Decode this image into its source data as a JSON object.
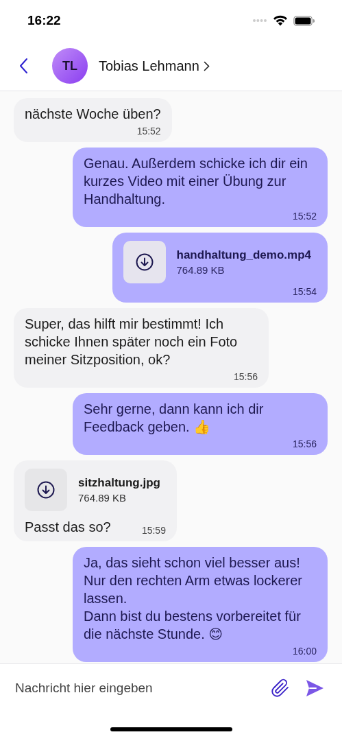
{
  "status_bar": {
    "time": "16:22"
  },
  "header": {
    "initials": "TL",
    "name": "Tobias Lehmann"
  },
  "messages": [
    {
      "kind": "text",
      "outgoing": false,
      "text": "nächste Woche üben?",
      "time": "15:52"
    },
    {
      "kind": "text",
      "outgoing": true,
      "text": "Genau. Außerdem schicke ich dir ein kurzes Video mit einer Übung zur Handhaltung.",
      "time": "15:52"
    },
    {
      "kind": "file",
      "outgoing": true,
      "file_name": "handhaltung_demo.mp4",
      "file_size": "764.89 KB",
      "time": "15:54"
    },
    {
      "kind": "text",
      "outgoing": false,
      "text": "Super, das hilft mir bestimmt! Ich schicke Ihnen später noch ein Foto meiner Sitzposition, ok?",
      "time": "15:56"
    },
    {
      "kind": "text",
      "outgoing": true,
      "text": "Sehr gerne, dann kann ich dir Feedback geben. 👍",
      "time": "15:56"
    },
    {
      "kind": "file",
      "outgoing": false,
      "file_name": "sitzhaltung.jpg",
      "file_size": "764.89 KB",
      "text": "Passt das so?",
      "time": "15:59"
    },
    {
      "kind": "text",
      "outgoing": true,
      "text": "Ja, das sieht schon viel besser aus! Nur den rechten Arm etwas lockerer lassen.\nDann bist du bestens vorbereitet für die nächste Stunde. 😊",
      "time": "16:00"
    }
  ],
  "composer": {
    "placeholder": "Nachricht hier eingeben"
  }
}
